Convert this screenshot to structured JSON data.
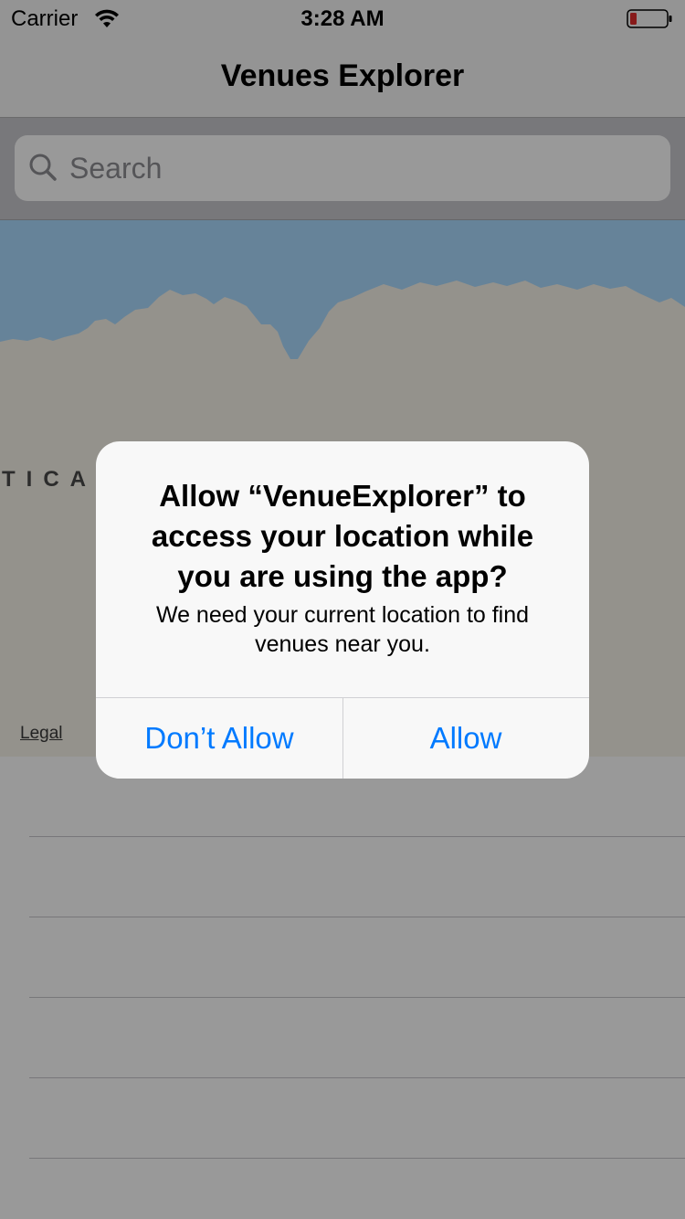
{
  "status_bar": {
    "carrier": "Carrier",
    "time": "3:28 AM",
    "battery_color": "#e22c2c"
  },
  "nav": {
    "title": "Venues Explorer"
  },
  "search": {
    "placeholder": "Search"
  },
  "map": {
    "region_label": "TICA",
    "legal_link": "Legal",
    "water_color": "#aadaff",
    "land_color": "#f7f3ea"
  },
  "alert": {
    "title": "Allow “VenueExplorer” to access your location while you are using the app?",
    "message": "We need your current location to find venues near you.",
    "buttons": {
      "deny": "Don’t Allow",
      "allow": "Allow"
    },
    "accent_color": "#007aff"
  }
}
